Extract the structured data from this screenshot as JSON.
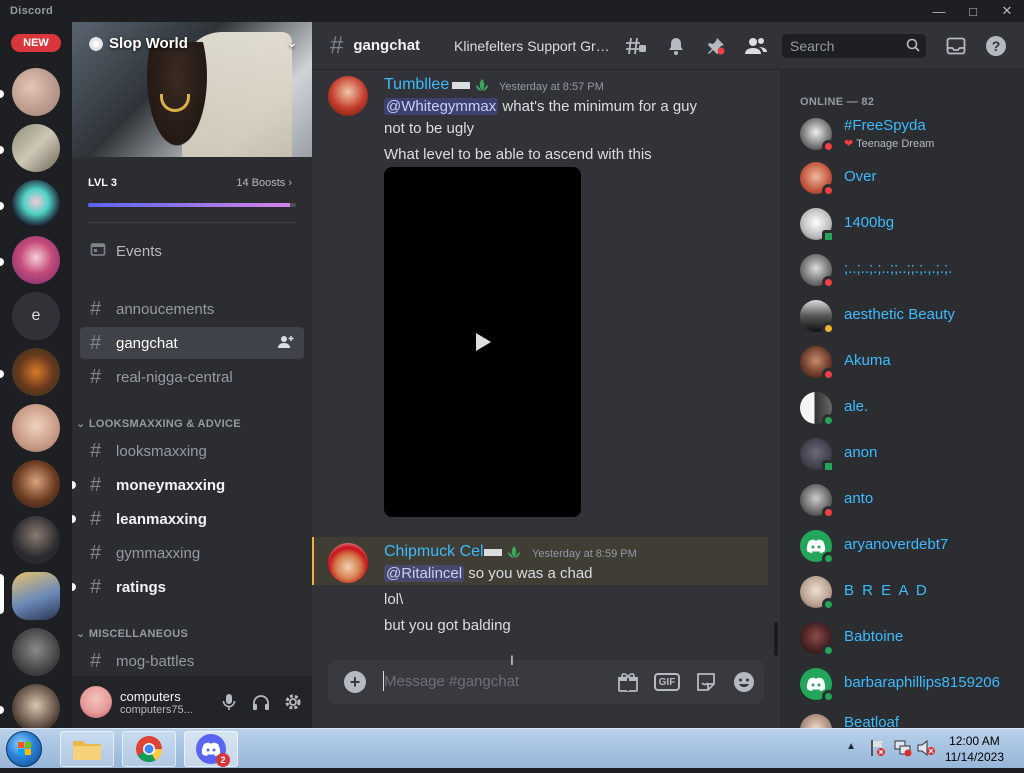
{
  "app": {
    "title": "Discord"
  },
  "rail": {
    "new_badge": "NEW",
    "letter_server": "e"
  },
  "server": {
    "name": "Slop World",
    "level": "LVL 3",
    "boosts": "14 Boosts",
    "boost_progress": 0.97
  },
  "sidebar": {
    "events_label": "Events",
    "channels_top": [
      {
        "name": "annoucements"
      },
      {
        "name": "gangchat"
      },
      {
        "name": "real-nigga-central"
      }
    ],
    "categories": [
      {
        "name": "LOOKSMAXXING & ADVICE",
        "channels": [
          "looksmaxxing",
          "moneymaxxing",
          "leanmaxxing",
          "gymmaxxing",
          "ratings"
        ]
      },
      {
        "name": "MISCELLANEOUS",
        "channels": [
          "mog-battles"
        ]
      }
    ]
  },
  "user": {
    "name": "computers",
    "tag": "computers75..."
  },
  "header": {
    "channel": "gangchat",
    "topic": "Klinefelters Support Gro...",
    "search_placeholder": "Search"
  },
  "messages": [
    {
      "author": "Tumbllee",
      "time": "Yesterday at 8:57 PM",
      "mention": "@Whitegymmax",
      "line1_rest": " what's the minimum for a guy",
      "line2": "not to be ugly",
      "line3": "What level to be able to ascend with this"
    },
    {
      "author": "Chipmuck Cel",
      "time": "Yesterday at 8:59 PM",
      "mention": "@Ritalincel",
      "line1_rest": " so you was a chad",
      "line2": "lol\\",
      "line3": "but you got balding"
    }
  ],
  "composer": {
    "placeholder": "Message #gangchat",
    "gif_label": "GIF"
  },
  "members": {
    "header": "ONLINE — 82",
    "list": [
      {
        "name": "#FreeSpyda",
        "sub": "Teenage Dream",
        "status": "dnd"
      },
      {
        "name": "Over",
        "status": "dnd"
      },
      {
        "name": "1400bg",
        "status": "mobile"
      },
      {
        "name": ";..;..;.;..;;..;;.;.,.;.;.",
        "status": "dnd"
      },
      {
        "name": "aesthetic Beauty",
        "status": "idle"
      },
      {
        "name": "Akuma",
        "status": "dnd"
      },
      {
        "name": "ale.",
        "status": "online"
      },
      {
        "name": "anon",
        "status": "mobile"
      },
      {
        "name": "anto",
        "status": "dnd"
      },
      {
        "name": "aryanoverdebt7",
        "status": "online"
      },
      {
        "name": "B R E A D",
        "status": "online"
      },
      {
        "name": "Babtoine",
        "status": "online"
      },
      {
        "name": "barbaraphillips8159206",
        "status": "online"
      },
      {
        "name": "Beatloaf",
        "status": "online"
      }
    ]
  },
  "taskbar": {
    "time": "12:00 AM",
    "date": "11/14/2023",
    "discord_badge": "2"
  }
}
